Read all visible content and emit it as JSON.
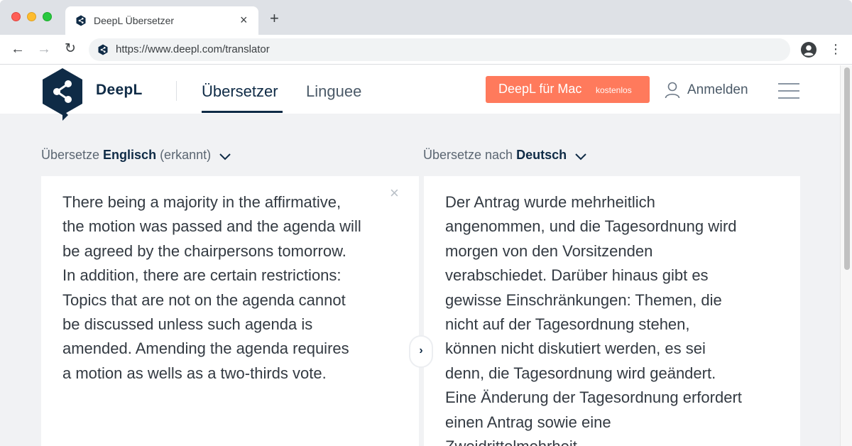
{
  "browser": {
    "tab_title": "DeepL Übersetzer",
    "tab_close": "×",
    "new_tab": "+",
    "url": "https://www.deepl.com/translator",
    "back": "←",
    "forward": "→",
    "reload": "↻",
    "menu": "⋮"
  },
  "header": {
    "brand": "DeepL",
    "nav": {
      "translator": "Übersetzer",
      "linguee": "Linguee"
    },
    "mac_button": {
      "label": "DeepL für Mac",
      "badge": "kostenlos"
    },
    "login": "Anmelden",
    "accent": "#ff7a5c",
    "brand_color": "#0f2b46"
  },
  "source": {
    "prefix": "Übersetze ",
    "language": "Englisch",
    "suffix": " (erkannt)",
    "clear": "×",
    "text": "There being a majority in the affirmative,\nthe motion was passed and the agenda will\nbe agreed by the chairpersons tomorrow.\nIn addition, there are certain restrictions:\nTopics that are not on the agenda cannot\nbe discussed unless such agenda is\namended. Amending the agenda requires\na motion as wells as a two-thirds vote."
  },
  "target": {
    "prefix": "Übersetze nach ",
    "language": "Deutsch",
    "text": "Der Antrag wurde mehrheitlich\nangenommen, und die Tagesordnung wird\nmorgen von den Vorsitzenden\nverabschiedet. Darüber hinaus gibt es\ngewisse Einschränkungen: Themen, die\nnicht auf der Tagesordnung stehen,\nkönnen nicht diskutiert werden, es sei\ndenn, die Tagesordnung wird geändert.\nEine Änderung der Tagesordnung erfordert\neinen Antrag sowie eine\nZweidrittelmehrheit."
  },
  "swap": "›",
  "icons": {
    "favicon": "deepl-logo-icon",
    "profile": "profile-icon",
    "user": "user-icon",
    "hamburger": "hamburger-menu-icon",
    "chevron": "chevron-down-icon"
  }
}
